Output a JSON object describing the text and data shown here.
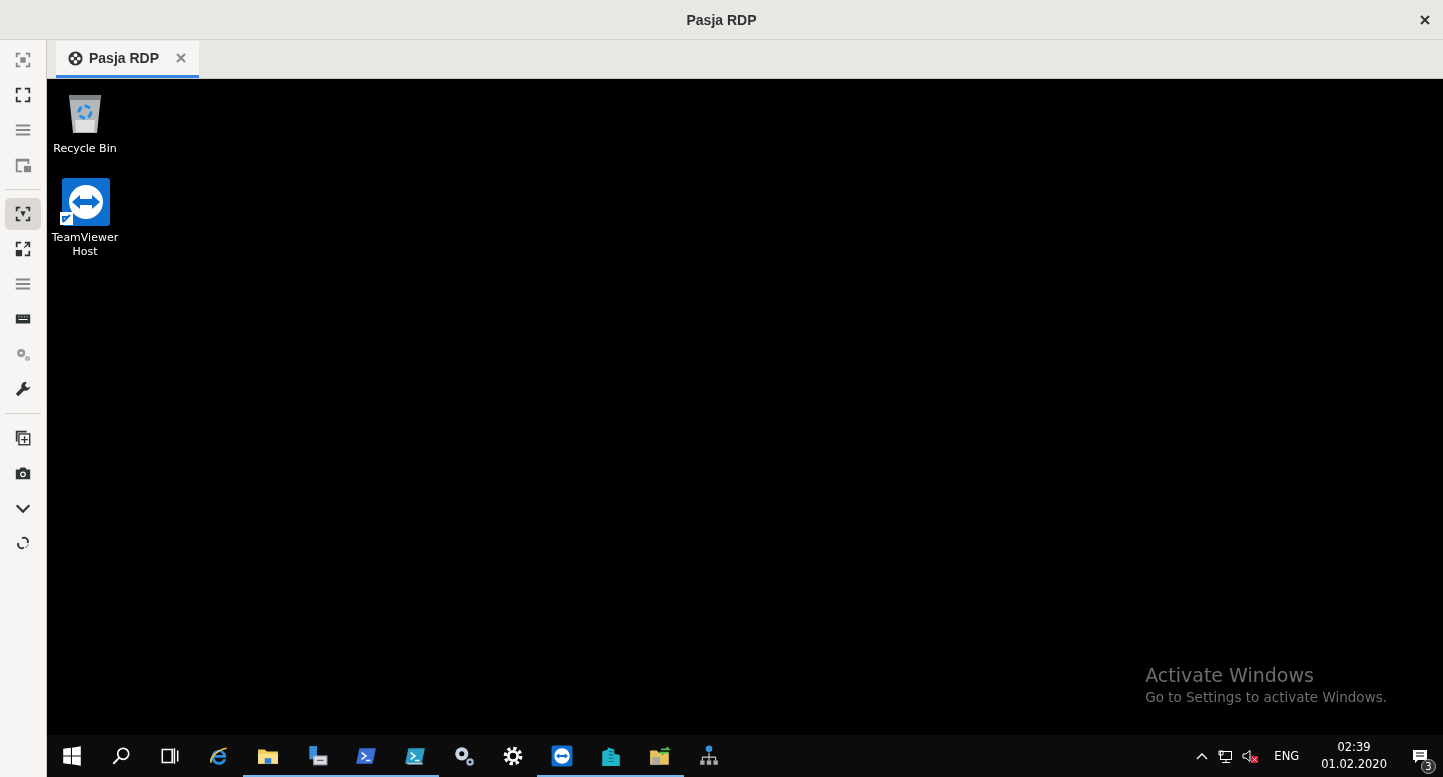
{
  "window": {
    "title": "Pasja RDP"
  },
  "sidebar": {
    "groups": [
      [
        {
          "selected": false
        },
        {
          "selected": false
        },
        {
          "selected": false
        },
        {
          "selected": false
        }
      ],
      [
        {
          "selected": true
        },
        {
          "selected": false
        },
        {
          "selected": false
        },
        {
          "selected": false
        },
        {
          "selected": false
        },
        {
          "selected": false
        }
      ],
      [
        {
          "selected": false
        },
        {
          "selected": false
        },
        {
          "selected": false
        },
        {
          "selected": false
        }
      ]
    ]
  },
  "tabs": [
    {
      "label": "Pasja RDP",
      "selected": true
    }
  ],
  "desktop": {
    "icons": [
      "Recycle Bin",
      "TeamViewer Host"
    ],
    "watermark": {
      "title": "Activate Windows",
      "text": "Go to Settings to activate Windows."
    }
  },
  "taskbar": {
    "items": [
      {
        "running": false
      },
      {
        "running": false
      },
      {
        "running": false
      },
      {
        "running": false
      },
      {
        "running": true
      },
      {
        "running": true
      },
      {
        "running": true
      },
      {
        "running": true
      },
      {
        "running": false
      },
      {
        "running": false
      },
      {
        "running": true
      },
      {
        "running": true
      },
      {
        "running": true
      },
      {
        "running": false
      }
    ],
    "tray": {
      "language": "ENG",
      "time": "02:39",
      "date": "01.02.2020",
      "notifications": "3"
    }
  }
}
